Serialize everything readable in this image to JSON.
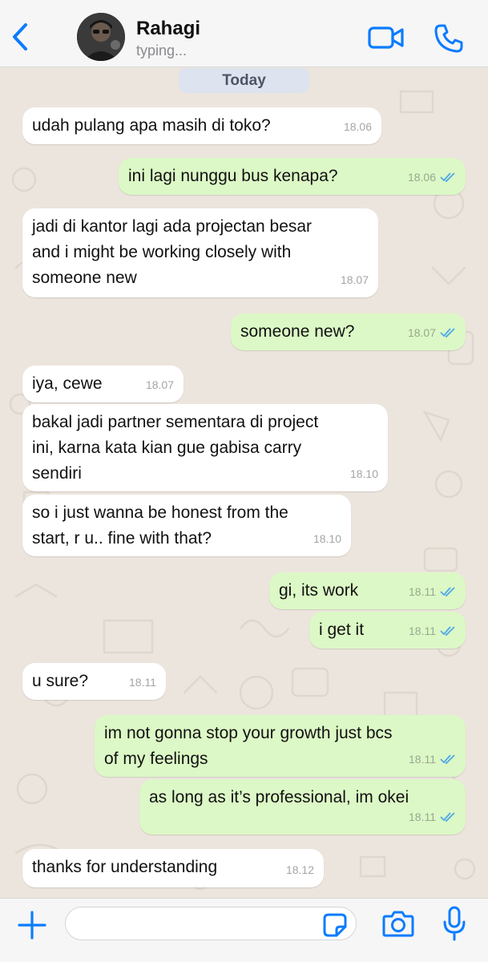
{
  "header": {
    "contact_name": "Rahagi",
    "status": "typing..."
  },
  "chat": {
    "date_label": "Today",
    "messages": [
      {
        "direction": "in",
        "text": "udah pulang apa masih di toko?",
        "time": "18.06"
      },
      {
        "direction": "out",
        "text": "ini lagi nunggu bus kenapa?",
        "time": "18.06",
        "read": true
      },
      {
        "direction": "in",
        "text": "jadi di kantor lagi ada projectan besar\nand i might be working closely with\nsomeone new",
        "time": "18.07"
      },
      {
        "direction": "out",
        "text": "someone new?",
        "time": "18.07",
        "read": true
      },
      {
        "direction": "in",
        "text": "iya, cewe",
        "time": "18.07"
      },
      {
        "direction": "in",
        "text": "bakal jadi partner sementara di project\nini, karna kata kian gue gabisa carry\nsendiri",
        "time": "18.10"
      },
      {
        "direction": "in",
        "text": "so i just wanna be honest from the\nstart, r u.. fine with that?",
        "time": "18.10"
      },
      {
        "direction": "out",
        "text": "gi, its work",
        "time": "18.11",
        "read": true
      },
      {
        "direction": "out",
        "text": "i get it",
        "time": "18.11",
        "read": true
      },
      {
        "direction": "in",
        "text": "u sure?",
        "time": "18.11"
      },
      {
        "direction": "out",
        "text": "im not gonna stop your growth just bcs\nof my feelings",
        "time": "18.11",
        "read": true
      },
      {
        "direction": "out",
        "text": "as long as it’s professional, im okei",
        "time": "18.11",
        "read": true
      },
      {
        "direction": "in",
        "text": "thanks for understanding",
        "time": "18.12"
      }
    ]
  },
  "input": {
    "value": "",
    "placeholder": ""
  },
  "icons": {
    "back": "chevron-left-icon",
    "video": "video-camera-icon",
    "call": "phone-icon",
    "plus": "plus-icon",
    "sticker": "sticker-icon",
    "camera": "camera-icon",
    "mic": "microphone-icon",
    "read_receipt": "double-check-icon"
  },
  "colors": {
    "accent": "#0a7cff",
    "incoming_bubble": "#ffffff",
    "outgoing_bubble": "#dcf8c6",
    "chat_background": "#ece5dd",
    "read_tick": "#4fa8e8"
  }
}
